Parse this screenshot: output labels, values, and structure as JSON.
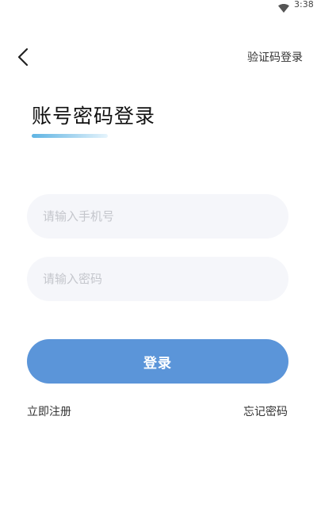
{
  "status_bar": {
    "time": "3:38",
    "wifi_icon": "wifi-icon"
  },
  "nav": {
    "back_icon": "chevron-left-icon",
    "switch_login_label": "验证码登录"
  },
  "header": {
    "title": "账号密码登录",
    "underline_colors": [
      "#5fb4e3",
      "#a8d6f0",
      "#e6f4fc"
    ]
  },
  "form": {
    "phone": {
      "value": "",
      "placeholder": "请输入手机号"
    },
    "password": {
      "value": "",
      "placeholder": "请输入密码"
    },
    "login_label": "登录"
  },
  "links": {
    "register": "立即注册",
    "forgot_password": "忘记密码"
  },
  "colors": {
    "primary": "#5b95d9",
    "input_bg": "#f5f6fa",
    "placeholder": "#c4c6cc",
    "text": "#333333"
  }
}
